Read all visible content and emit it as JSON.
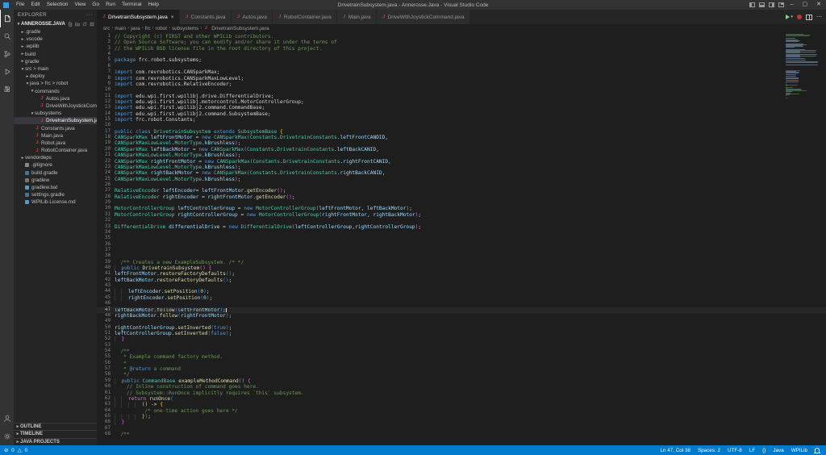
{
  "window": {
    "title": "DrivetrainSubsystem.java - Annerosse.Java - Visual Studio Code",
    "menus": [
      "File",
      "Edit",
      "Selection",
      "View",
      "Go",
      "Run",
      "Terminal",
      "Help"
    ]
  },
  "tabs": [
    {
      "label": "DrivetrainSubsystem.java",
      "active": true
    },
    {
      "label": "Constants.java",
      "active": false
    },
    {
      "label": "Autos.java",
      "active": false
    },
    {
      "label": "RobotContainer.java",
      "active": false
    },
    {
      "label": "Main.java",
      "active": false
    },
    {
      "label": "DriveWithJoystickCommand.java",
      "active": false
    }
  ],
  "breadcrumb": [
    "src",
    "main",
    "java",
    "frc",
    "robot",
    "subsystems",
    "DrivetrainSubsystem.java"
  ],
  "explorer": {
    "header": "EXPLORER",
    "root": "ANNEROSSE.JAVA",
    "items": [
      {
        "label": ".gradle",
        "indent": 1,
        "kind": "folder",
        "open": false
      },
      {
        "label": ".vscode",
        "indent": 1,
        "kind": "folder",
        "open": false
      },
      {
        "label": ".wpilib",
        "indent": 1,
        "kind": "folder",
        "open": false
      },
      {
        "label": "build",
        "indent": 1,
        "kind": "folder",
        "open": false
      },
      {
        "label": "gradle",
        "indent": 1,
        "kind": "folder",
        "open": false
      },
      {
        "label": "src > main",
        "indent": 1,
        "kind": "folder",
        "open": true
      },
      {
        "label": "deploy",
        "indent": 2,
        "kind": "folder",
        "open": false
      },
      {
        "label": "java > frc > robot",
        "indent": 2,
        "kind": "folder",
        "open": true
      },
      {
        "label": "commands",
        "indent": 3,
        "kind": "folder",
        "open": true
      },
      {
        "label": "Autos.java",
        "indent": 4,
        "kind": "file",
        "icon": "java"
      },
      {
        "label": "DriveWithJoystickCommand.java",
        "indent": 4,
        "kind": "file",
        "icon": "java"
      },
      {
        "label": "subsystems",
        "indent": 3,
        "kind": "folder",
        "open": true
      },
      {
        "label": "DrivetrainSubsystem.java",
        "indent": 4,
        "kind": "file",
        "icon": "java",
        "selected": true
      },
      {
        "label": "Constants.java",
        "indent": 3,
        "kind": "file",
        "icon": "java"
      },
      {
        "label": "Main.java",
        "indent": 3,
        "kind": "file",
        "icon": "java"
      },
      {
        "label": "Robot.java",
        "indent": 3,
        "kind": "file",
        "icon": "java"
      },
      {
        "label": "RobotContainer.java",
        "indent": 3,
        "kind": "file",
        "icon": "java"
      },
      {
        "label": "vendordeps",
        "indent": 1,
        "kind": "folder",
        "open": false
      },
      {
        "label": ".gitignore",
        "indent": 1,
        "kind": "file",
        "icon": "git"
      },
      {
        "label": "build.gradle",
        "indent": 1,
        "kind": "file",
        "icon": "gradle"
      },
      {
        "label": "gradlew",
        "indent": 1,
        "kind": "file",
        "icon": "plain"
      },
      {
        "label": "gradlew.bat",
        "indent": 1,
        "kind": "file",
        "icon": "bat"
      },
      {
        "label": "settings.gradle",
        "indent": 1,
        "kind": "file",
        "icon": "gradle"
      },
      {
        "label": "WPILib-License.md",
        "indent": 1,
        "kind": "file",
        "icon": "md"
      }
    ],
    "sections": [
      "OUTLINE",
      "TIMELINE",
      "JAVA PROJECTS"
    ]
  },
  "editor": {
    "current_line": 47,
    "lines": [
      "// Copyright (c) FIRST and other WPILib contributors.",
      "// Open Source Software; you can modify and/or share it under the terms of",
      "// the WPILib BSD license file in the root directory of this project.",
      "",
      "package frc.robot.subsystems;",
      "",
      "import com.revrobotics.CANSparkMax;",
      "import com.revrobotics.CANSparkMaxLowLevel;",
      "import com.revrobotics.RelativeEncoder;",
      "",
      "import edu.wpi.first.wpilibj.drive.DifferentialDrive;",
      "import edu.wpi.first.wpilibj.motorcontrol.MotorControllerGroup;",
      "import edu.wpi.first.wpilibj2.command.CommandBase;",
      "import edu.wpi.first.wpilibj2.command.SubsystemBase;",
      "import frc.robot.Constants;",
      "",
      "public class DrivetrainSubsystem extends SubsystemBase {",
      "CANSparkMax leftFrontMotor = new CANSparkMax(Constants.DrivetrainConstants.leftFrontCANDID,",
      "CANSparkMaxLowLevel.MotorType.kBrushless);",
      "CANSparkMax leftBackMotor = new CANSparkMax(Constants.DrivetrainConstants.leftBackCANID,",
      "CANSparkMaxLowLevel.MotorType.kBrushless);",
      "CANSparkMax rightFrontMotor = new CANSparkMax(Constants.DrivetrainConstants.rightFrontCANID,",
      "CANSparkMaxLowLevel.MotorType.kBrushless);",
      "CANSparkMax rightBackMotor = new CANSparkMax(Constants.DrivetrainConstants.rightBackCANID,",
      "CANSparkMaxLowLevel.MotorType.kBrushless);",
      "",
      "RelativeEncoder leftEncoder= leftFrontMotor.getEncoder();",
      "RelativeEncoder rightEncoder = rightFrontMotor.getEncoder();",
      "",
      "MotorControllerGroup leftControllerGroup = new MotorControllerGroup(leftFrontMotor, leftBackMotor);",
      "MotorControllerGroup rightControllerGroup = new MotorControllerGroup(rightFrontMotor, rightBackMotor);",
      "",
      "DifferentialDrive differentialDrive = new DifferentialDrive(leftControllerGroup,rightControllerGroup);",
      "",
      "",
      "",
      "",
      "",
      "  /** Creates a new ExampleSubsystem. /* */",
      "  public DrivetrainSubsystem() {",
      "leftFrontMotor.restoreFactoryDefaults();",
      "leftBackMotor.restoreFactoryDefaults();",
      "",
      "    leftEncoder.setPosition(0);",
      "    rightEncoder.setPosition(0);",
      "",
      "leftBackMotor.follow(leftFrontMotor);",
      "rightBackMotor.follow(rightFrontMotor);",
      "",
      "rightControllerGroup.setInverted(true);",
      "leftControllerGroup.setInverted(false);",
      "  }",
      "",
      "  /**",
      "   * Example command factory method.",
      "   *",
      "   * @return a command",
      "   */",
      "  public CommandBase exampleMethodCommand() {",
      "    // Inline construction of command goes here.",
      "    // Subsystem::RunOnce implicitly requires `this` subsystem.",
      "    return runOnce(",
      "        () -> {",
      "          /* one-time action goes here */",
      "        });",
      "  }",
      "",
      "  /**"
    ]
  },
  "status_bar": {
    "errors": "0",
    "warnings": "0",
    "items": [
      "Ln 47, Col 38",
      "Spaces: 2",
      "UTF-8",
      "LF",
      "{}",
      "Java",
      "WPILib"
    ]
  },
  "colors": {
    "accent": "#007acc",
    "java_icon": "#cc3e44",
    "gradle_icon": "#3b77a5",
    "bat_icon": "#4d9ccd",
    "md_icon": "#4d9ccd",
    "git_icon": "#8a8a8a",
    "plain_icon": "#777777",
    "comment": "#6a9955",
    "keyword": "#569cd6",
    "type": "#4ec9b0",
    "variable": "#9cdcfe",
    "function": "#dcdcaa"
  }
}
